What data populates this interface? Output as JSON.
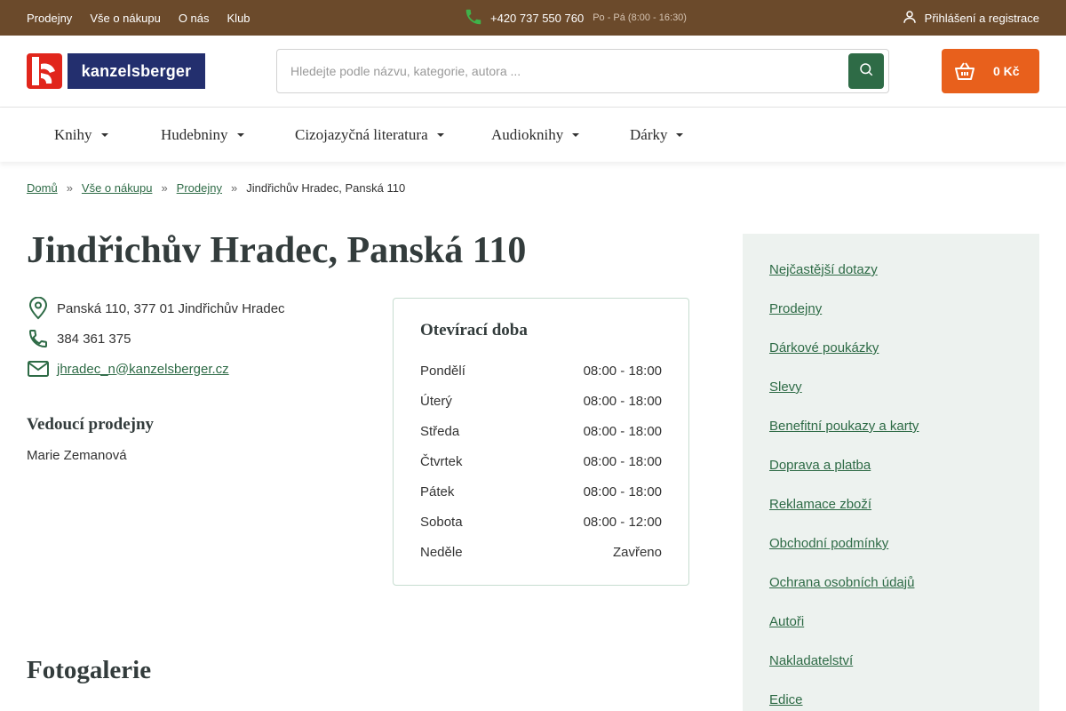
{
  "topbar": {
    "links": [
      "Prodejny",
      "Vše o nákupu",
      "O nás",
      "Klub"
    ],
    "phone": "+420 737 550 760",
    "phone_hours": "Po - Pá (8:00 - 16:30)",
    "login_label": "Přihlášení a registrace"
  },
  "header": {
    "logo_text": "kanzelsberger",
    "search_placeholder": "Hledejte podle názvu, kategorie, autora ...",
    "cart_amount": "0 Kč"
  },
  "categories": [
    "Knihy",
    "Hudebniny",
    "Cizojazyčná literatura",
    "Audioknihy",
    "Dárky"
  ],
  "breadcrumb": {
    "links": [
      "Domů",
      "Vše o nákupu",
      "Prodejny"
    ],
    "current": "Jindřichův Hradec, Panská 110",
    "separator": "»"
  },
  "store": {
    "title": "Jindřichův Hradec, Panská 110",
    "address": "Panská 110, 377 01 Jindřichův Hradec",
    "phone": "384 361 375",
    "email": "jhradec_n@kanzelsberger.cz",
    "manager_heading": "Vedoucí prodejny",
    "manager_name": "Marie Zemanová"
  },
  "opening_hours": {
    "heading": "Otevírací doba",
    "rows": [
      {
        "day": "Pondělí",
        "time": "08:00 - 18:00"
      },
      {
        "day": "Úterý",
        "time": "08:00 - 18:00"
      },
      {
        "day": "Středa",
        "time": "08:00 - 18:00"
      },
      {
        "day": "Čtvrtek",
        "time": "08:00 - 18:00"
      },
      {
        "day": "Pátek",
        "time": "08:00 - 18:00"
      },
      {
        "day": "Sobota",
        "time": "08:00 - 12:00"
      },
      {
        "day": "Neděle",
        "time": "Zavřeno"
      }
    ]
  },
  "gallery_heading": "Fotogalerie",
  "sidebar": {
    "links": [
      "Nejčastější dotazy",
      "Prodejny",
      "Dárkové poukázky",
      "Slevy",
      "Benefitní poukazy a karty",
      "Doprava a platba",
      "Reklamace zboží",
      "Obchodní podmínky",
      "Ochrana osobních údajů",
      "Autoři",
      "Nakladatelství",
      "Edice"
    ]
  },
  "colors": {
    "topbar": "#6b4a2b",
    "accent_green": "#2e6b46",
    "cart_orange": "#e8601c",
    "logo_red": "#e1261c",
    "logo_navy": "#232f6e",
    "sidebar_bg": "#edf2ef"
  },
  "icons": [
    "phone-icon",
    "user-icon",
    "search-icon",
    "basket-icon",
    "map-pin-icon",
    "envelope-icon",
    "caret-down-icon"
  ]
}
